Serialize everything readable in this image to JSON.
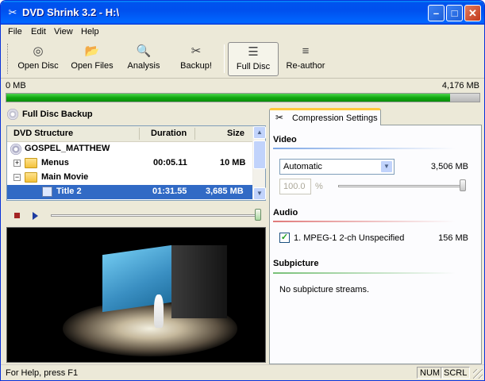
{
  "window": {
    "title": "DVD Shrink 3.2 - H:\\",
    "title_icon": "dvd-shrink-app-icon",
    "minimize": "–",
    "maximize": "□",
    "close": "✕"
  },
  "menubar": [
    "File",
    "Edit",
    "View",
    "Help"
  ],
  "toolbar": {
    "items": [
      {
        "label": "Open Disc",
        "icon": "disc-icon",
        "glyph": "◎"
      },
      {
        "label": "Open Files",
        "icon": "open-folder-icon",
        "glyph": "📂"
      },
      {
        "label": "Analysis",
        "icon": "magnifier-icon",
        "glyph": "🔍"
      },
      {
        "label": "Backup!",
        "icon": "backup-icon",
        "glyph": "✂"
      },
      {
        "label": "Full Disc",
        "icon": "disc-stack-icon",
        "glyph": "☰",
        "active": true
      },
      {
        "label": "Re-author",
        "icon": "reauthor-icon",
        "glyph": "≡"
      }
    ]
  },
  "size_bar": {
    "min_label": "0 MB",
    "max_label": "4,176 MB",
    "fill_fraction": 0.938
  },
  "left_panel": {
    "title": "Full Disc Backup",
    "columns": {
      "structure": "DVD Structure",
      "duration": "Duration",
      "size": "Size"
    },
    "rows": [
      {
        "name": "GOSPEL_MATTHEW",
        "duration": "",
        "size": "",
        "icon": "disc-icon"
      },
      {
        "name": "Menus",
        "duration": "00:05.11",
        "size": "10 MB",
        "icon": "folder-icon",
        "expander": "+"
      },
      {
        "name": "Main Movie",
        "duration": "",
        "size": "",
        "icon": "folder-icon",
        "expander": "−"
      },
      {
        "name": "Title 2",
        "duration": "01:31.55",
        "size": "3,685 MB",
        "icon": "title-icon",
        "selected": true
      }
    ]
  },
  "right_panel": {
    "tab_label": "Compression Settings",
    "video": {
      "heading": "Video",
      "mode": "Automatic",
      "size": "3,506 MB",
      "percent": "100.0",
      "percent_sign": "%"
    },
    "audio": {
      "heading": "Audio",
      "track": "1. MPEG-1 2-ch Unspecified",
      "size": "156 MB",
      "checked": true
    },
    "subpicture": {
      "heading": "Subpicture",
      "message": "No subpicture streams."
    },
    "colors": {
      "video_line": "#7fa8e6",
      "audio_line": "#e07a7a",
      "sub_line": "#78c078",
      "tab_accent": "#ffc83c"
    }
  },
  "statusbar": {
    "text": "For Help, press F1",
    "num": "NUM",
    "scrl": "SCRL"
  }
}
